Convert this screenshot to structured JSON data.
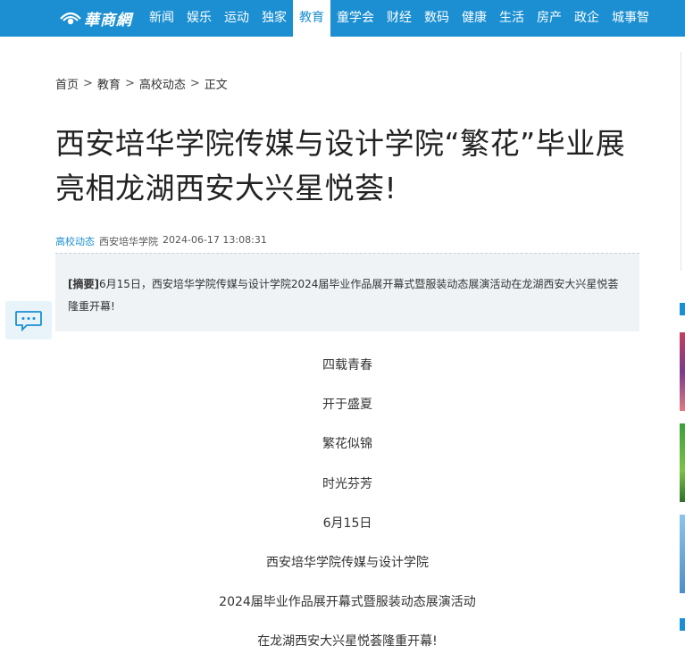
{
  "site": {
    "logo_text": "華商網"
  },
  "nav": {
    "items": [
      "新闻",
      "娱乐",
      "运动",
      "独家",
      "教育",
      "童学会",
      "财经",
      "数码",
      "健康",
      "生活",
      "房产",
      "政企",
      "城事智"
    ],
    "active": "教育"
  },
  "breadcrumb": {
    "home": "首页",
    "section": "教育",
    "subsection": "高校动态",
    "current": "正文",
    "separator": ">"
  },
  "article": {
    "title": "西安培华学院传媒与设计学院“繁花”毕业展亮相龙湖西安大兴星悦荟!",
    "category": "高校动态",
    "source": "西安培华学院",
    "datetime": "2024-06-17 13:08:31",
    "summary_label": "[摘要]",
    "summary_text": "6月15日，西安培华学院传媒与设计学院2024届毕业作品展开幕式暨服装动态展演活动在龙湖西安大兴星悦荟隆重开幕!",
    "paragraphs": [
      "四载青春",
      "开于盛夏",
      "繁花似锦",
      "时光芬芳",
      "6月15日",
      "西安培华学院传媒与设计学院",
      "2024届毕业作品展开幕式暨服装动态展演活动",
      "在龙湖西安大兴星悦荟隆重开幕!"
    ]
  },
  "icons": {
    "comment": "comment-icon",
    "logo_mark": "eye-logo-icon"
  },
  "colors": {
    "brand": "#1b8fd2",
    "summary_bg": "#eff3f6",
    "comment_bg": "#e8f3fa"
  }
}
